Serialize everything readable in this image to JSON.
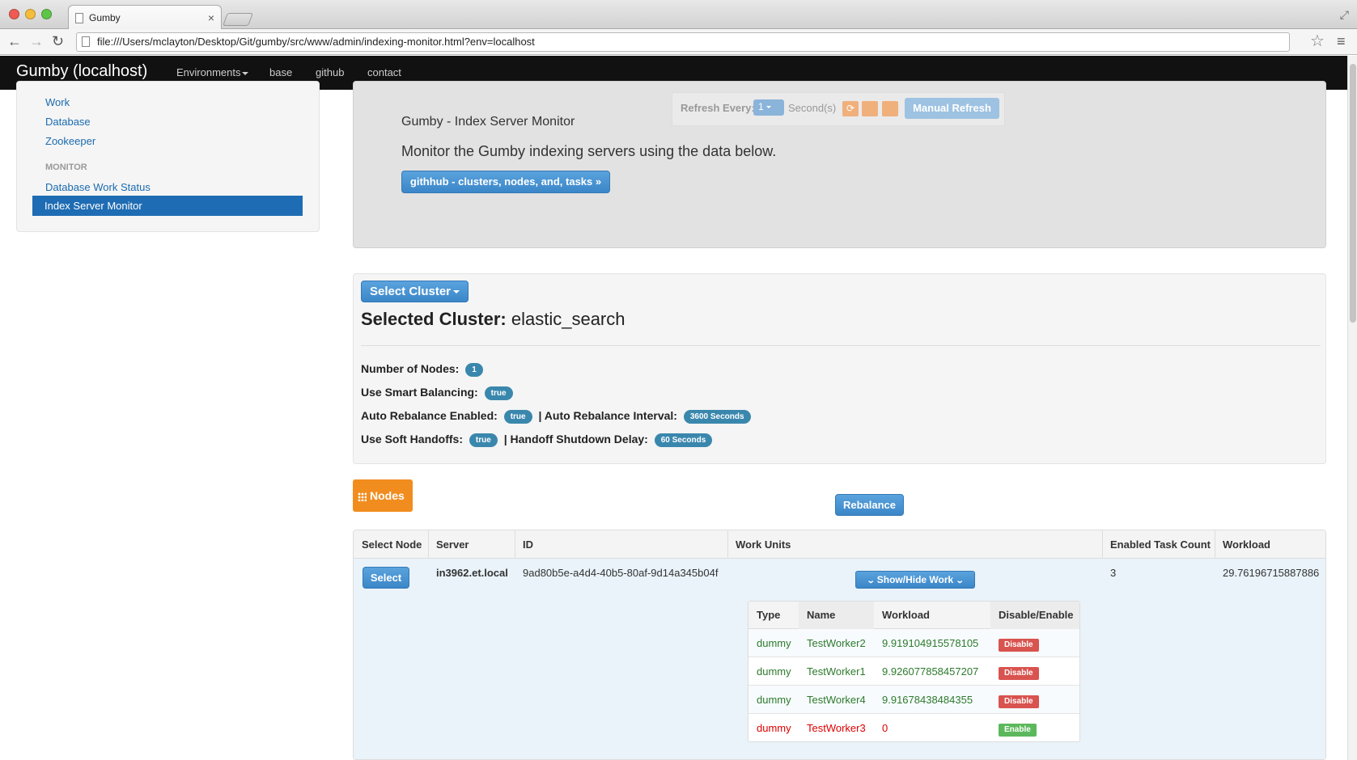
{
  "browser": {
    "tab_title": "Gumby",
    "url": "file:///Users/mclayton/Desktop/Git/gumby/src/www/admin/indexing-monitor.html?env=localhost"
  },
  "navbar": {
    "brand": "Gumby (localhost)",
    "links": [
      "Environments",
      "base",
      "github",
      "contact"
    ]
  },
  "sidebar": {
    "items": [
      "Work",
      "Database",
      "Zookeeper"
    ],
    "section_header": "MONITOR",
    "monitor_items": [
      "Database Work Status",
      "Index Server Monitor"
    ]
  },
  "refresh": {
    "label": "Refresh Every:",
    "value": "1",
    "unit": "Second(s)",
    "manual_label": "Manual Refresh"
  },
  "hero": {
    "title": "Gumby - Index Server Monitor",
    "description": "Monitor the Gumby indexing servers using the data below.",
    "button": "githhub - clusters, nodes, and, tasks »"
  },
  "cluster": {
    "select_label": "Select Cluster",
    "selected_label": "Selected Cluster:",
    "selected_value": "elastic_search",
    "num_nodes_label": "Number of Nodes:",
    "num_nodes": "1",
    "smart_balancing_label": "Use Smart Balancing:",
    "smart_balancing": "true",
    "auto_rebalance_label": "Auto Rebalance Enabled:",
    "auto_rebalance": "true",
    "auto_rebalance_interval_label": "| Auto Rebalance Interval:",
    "auto_rebalance_interval": "3600 Seconds",
    "soft_handoffs_label": "Use Soft Handoffs:",
    "soft_handoffs": "true",
    "handoff_delay_label": "| Handoff Shutdown Delay:",
    "handoff_delay": "60 Seconds"
  },
  "nodes": {
    "button": "Nodes",
    "rebalance": "Rebalance",
    "headers": [
      "Select Node",
      "Server",
      "ID",
      "Work Units",
      "Enabled Task Count",
      "Workload"
    ],
    "row": {
      "select": "Select",
      "server": "in3962.et.local",
      "id": "9ad80b5e-a4d4-40b5-80af-9d14a345b04f",
      "show_hide": "Show/Hide Work",
      "task_count": "3",
      "workload": "29.76196715887886"
    }
  },
  "work_units": {
    "headers": [
      "Type",
      "Name",
      "Workload",
      "Disable/Enable"
    ],
    "rows": [
      {
        "type": "dummy",
        "name": "TestWorker2",
        "workload": "9.919104915578105",
        "action": "Disable"
      },
      {
        "type": "dummy",
        "name": "TestWorker1",
        "workload": "9.926077858457207",
        "action": "Disable"
      },
      {
        "type": "dummy",
        "name": "TestWorker4",
        "workload": "9.91678438484355",
        "action": "Disable"
      },
      {
        "type": "dummy",
        "name": "TestWorker3",
        "workload": "0",
        "action": "Enable"
      }
    ]
  },
  "colors": {
    "primary": "#3b86c8",
    "sidebar_active": "#1e6cb3",
    "nodes_orange": "#f18d1f",
    "badge": "#3a87ad",
    "danger": "#d9534f",
    "success": "#5cb85c"
  }
}
